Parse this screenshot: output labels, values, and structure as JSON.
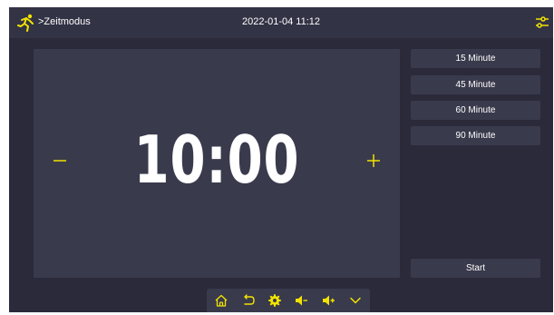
{
  "header": {
    "title": ">Zeitmodus",
    "datetime": "2022-01-04 11:12",
    "left_icon": "runner-icon",
    "right_icon": "sliders-icon"
  },
  "timer": {
    "display": "10:00",
    "minus_label": "−",
    "plus_label": "+"
  },
  "presets": [
    {
      "label": "15 Minute"
    },
    {
      "label": "45 Minute"
    },
    {
      "label": "60 Minute"
    },
    {
      "label": "90 Minute"
    }
  ],
  "start_label": "Start",
  "bottom_nav": [
    {
      "icon": "home-icon"
    },
    {
      "icon": "back-icon"
    },
    {
      "icon": "settings-icon"
    },
    {
      "icon": "volume-down-icon"
    },
    {
      "icon": "volume-up-icon"
    },
    {
      "icon": "chevron-down-icon"
    }
  ],
  "colors": {
    "accent": "#f2e300",
    "background": "#2a2a3b",
    "panel": "#393a4c",
    "header": "#333346"
  }
}
